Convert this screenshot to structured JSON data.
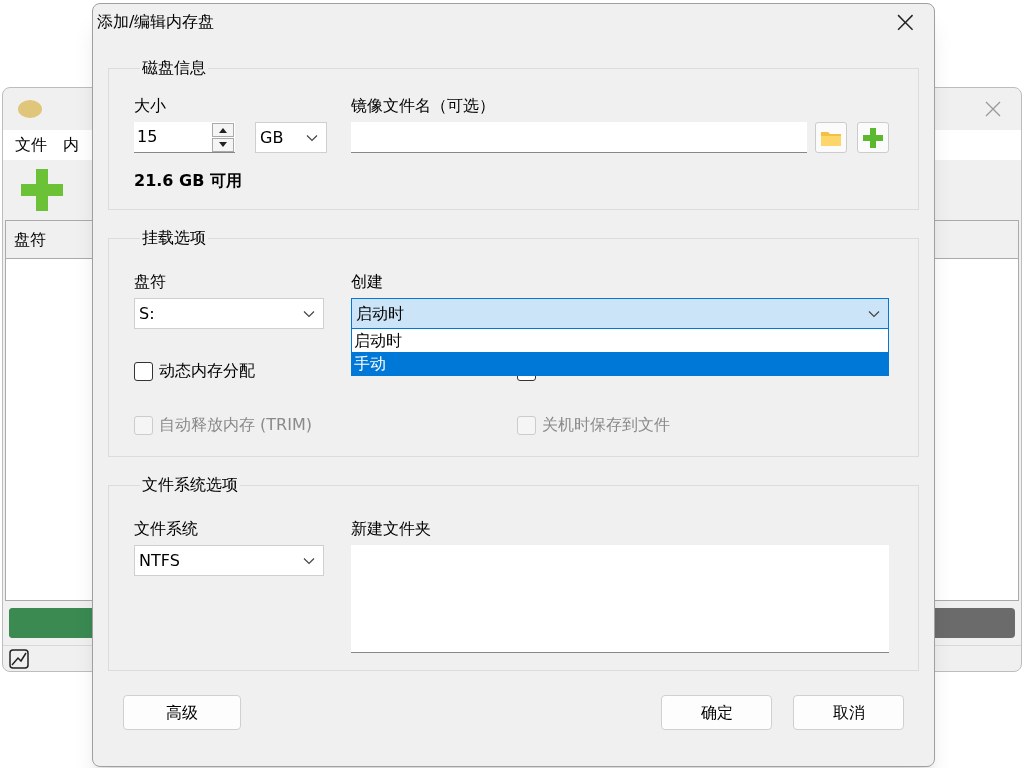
{
  "main_window": {
    "menu": [
      "文件",
      "内"
    ],
    "table": {
      "columns": [
        "盘符"
      ]
    },
    "usage": {
      "level": 0.5
    }
  },
  "dialog": {
    "title": "添加/编辑内存盘",
    "close": "×",
    "disk_info": {
      "legend": "磁盘信息",
      "size_label": "大小",
      "size_value": "15",
      "unit": "GB",
      "image_label": "镜像文件名（可选）",
      "free": "21.6 GB 可用"
    },
    "mount": {
      "legend": "挂载选项",
      "drive_label": "盘符",
      "drive_value": "S:",
      "create_label": "创建",
      "create_value": "启动时",
      "create_options": [
        {
          "label": "启动时",
          "selected": false
        },
        {
          "label": "手动",
          "selected": true
        }
      ],
      "checkboxes": [
        {
          "label": "动态内存分配",
          "checked": false,
          "disabled": false
        },
        {
          "checked": false,
          "disabled": false
        },
        {
          "label": "自动释放内存 (TRIM)",
          "checked": false,
          "disabled": true
        },
        {
          "label": "关机时保存到文件",
          "checked": false,
          "disabled": true
        }
      ]
    },
    "filesystem": {
      "legend": "文件系统选项",
      "fs_label": "文件系统",
      "fs_value": "NTFS",
      "folder_label": "新建文件夹"
    },
    "buttons": {
      "advanced": "高级",
      "ok": "确定",
      "cancel": "取消"
    }
  }
}
